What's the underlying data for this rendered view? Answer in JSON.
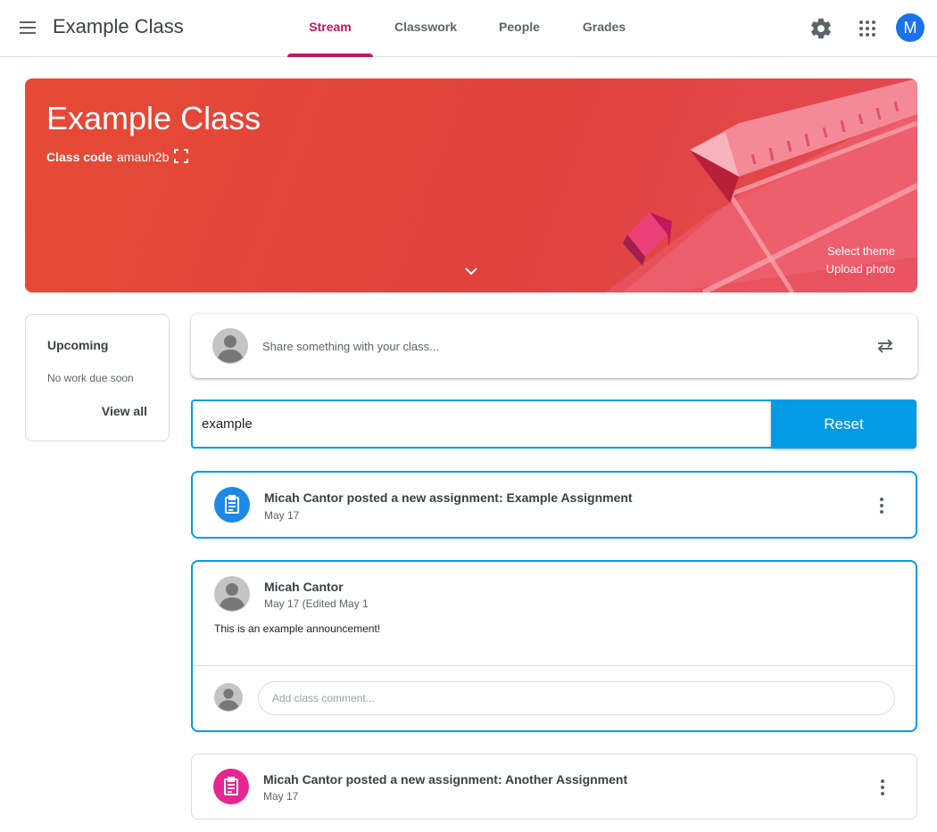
{
  "header": {
    "app_title": "Example Class",
    "tabs": [
      {
        "label": "Stream",
        "active": true
      },
      {
        "label": "Classwork",
        "active": false
      },
      {
        "label": "People",
        "active": false
      },
      {
        "label": "Grades",
        "active": false
      }
    ],
    "avatar_initial": "M",
    "icons": [
      "menu-icon",
      "settings-icon",
      "apps-icon"
    ]
  },
  "banner": {
    "title": "Example Class",
    "class_code_label": "Class code",
    "class_code": "amauh2b",
    "select_theme": "Select theme",
    "upload_photo": "Upload photo",
    "color": "#e0423d"
  },
  "upcoming": {
    "title": "Upcoming",
    "empty_text": "No work due soon",
    "view_all": "View all"
  },
  "share": {
    "placeholder": "Share something with your class..."
  },
  "search": {
    "value": "example",
    "reset_label": "Reset"
  },
  "stream": {
    "assignment1": {
      "title": "Micah Cantor posted a new assignment: Example Assignment",
      "date": "May 17",
      "icon_color": "#1e88e5"
    },
    "announcement": {
      "author": "Micah Cantor",
      "date": "May 17 (Edited May 1",
      "text": "This is an example announcement!",
      "comment_placeholder": "Add class comment..."
    },
    "assignment2": {
      "title": "Micah Cantor posted a new assignment: Another Assignment",
      "date": "May 17",
      "icon_color": "#e52592"
    }
  },
  "colors": {
    "accent": "#c2185b",
    "selection_blue": "#039be5"
  }
}
